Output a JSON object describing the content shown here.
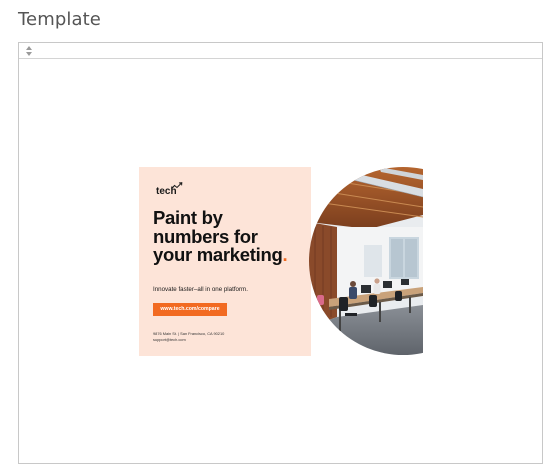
{
  "section": {
    "title": "Template"
  },
  "frame": {
    "sort_icon": "up-down-arrows-icon"
  },
  "template": {
    "logo": "tech",
    "headline_lines": [
      "Paint by",
      "numbers for",
      "your marketing"
    ],
    "headline_punct": ".",
    "tagline": "Innovate faster–all in one platform.",
    "cta_label": "www.tech.com/compare",
    "address_line1": "9876 Main St. | San Francisco, CA 90210",
    "address_line2": "support@tech.com",
    "photo_alt": "office-photo",
    "colors": {
      "panel_bg": "#fde4d8",
      "accent": "#f26a21",
      "headline": "#111111"
    }
  }
}
